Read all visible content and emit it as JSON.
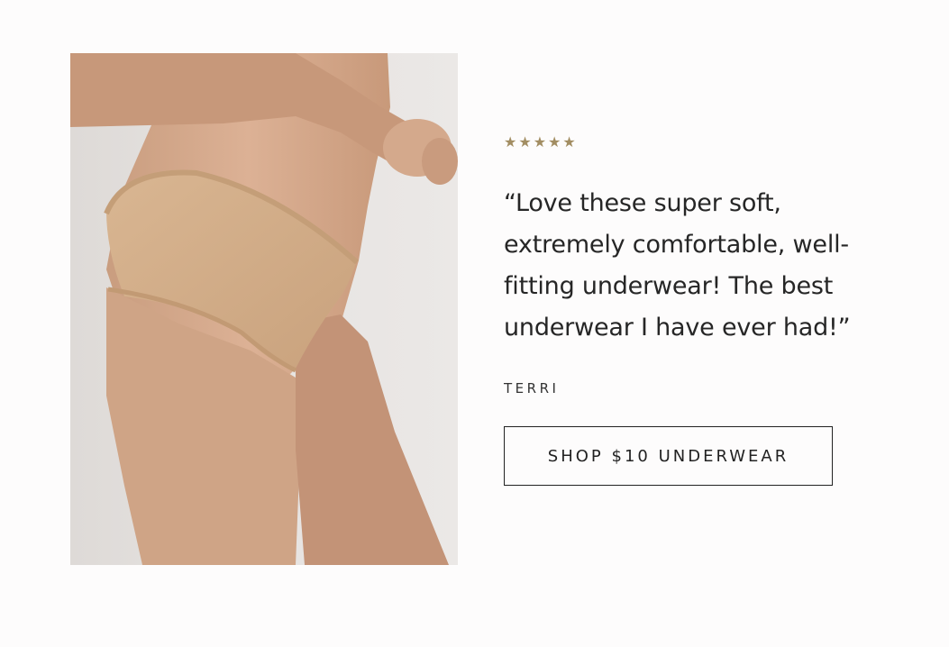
{
  "review": {
    "stars_text": "★★★★★",
    "rating": 5,
    "quote": "“Love these super soft, extremely comfortable, well-fitting underwear! The best underwear I have ever had!”",
    "author": "TERRI"
  },
  "cta": {
    "label": "SHOP $10 UNDERWEAR"
  },
  "colors": {
    "star": "#a28d62",
    "text": "#222222",
    "background": "#fdfcfc"
  }
}
